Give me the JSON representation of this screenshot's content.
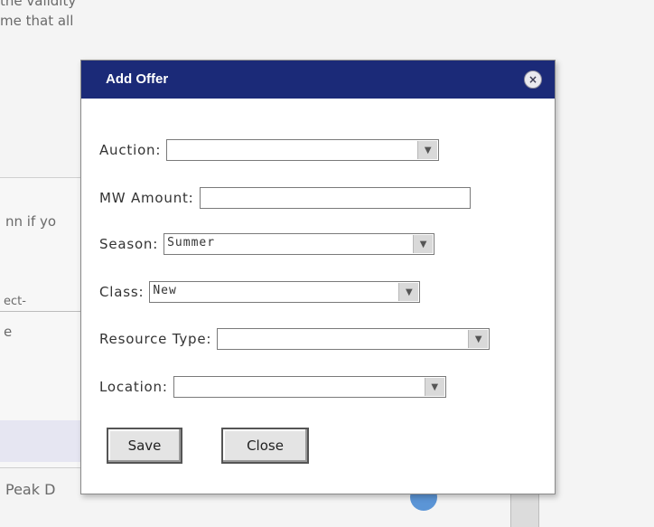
{
  "background": {
    "line1": "the validity",
    "line2": "me that all",
    "line3": "nn if yo",
    "select_text": "ect-",
    "line4": "e",
    "line5": "Peak D"
  },
  "dialog": {
    "title": "Add Offer",
    "close_icon": "×",
    "fields": {
      "auction": {
        "label": "Auction:",
        "value": ""
      },
      "mw_amount": {
        "label": "MW Amount:",
        "value": ""
      },
      "season": {
        "label": "Season:",
        "value": "Summer"
      },
      "class": {
        "label": "Class:",
        "value": "New"
      },
      "resource_type": {
        "label": "Resource Type:",
        "value": ""
      },
      "location": {
        "label": "Location:",
        "value": ""
      }
    },
    "arrow_glyph": "▼",
    "buttons": {
      "save": "Save",
      "close": "Close"
    }
  },
  "colors": {
    "titlebar": "#1b2a78",
    "page": "#f4f4f4"
  }
}
